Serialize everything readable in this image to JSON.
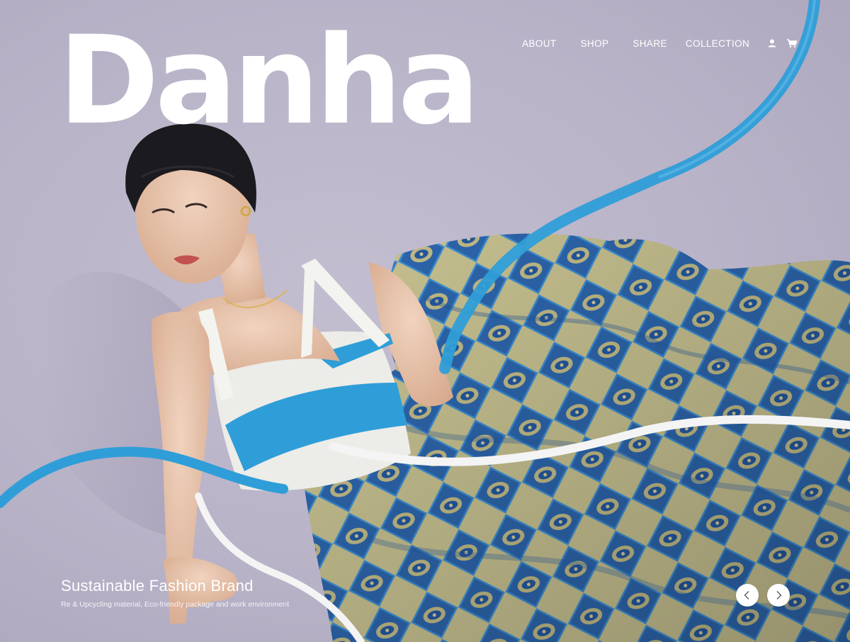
{
  "brand": {
    "logo": "Danha"
  },
  "nav": {
    "items": [
      {
        "label": "ABOUT"
      },
      {
        "label": "SHOP"
      },
      {
        "label": "SHARE"
      },
      {
        "label": "COLLECTION"
      }
    ],
    "icons": [
      "user-icon",
      "cart-icon"
    ]
  },
  "hero": {
    "title": "Sustainable Fashion Brand",
    "subtitle": "Re & Upcycling material, Eco-friendly package and work environment",
    "image": "model-in-blue-patterned-hanbok-photo"
  },
  "carousel": {
    "prev_icon": "chevron-left-icon",
    "next_icon": "chevron-right-icon"
  },
  "colors": {
    "background": "#b9b3c8",
    "ribbon_blue": "#2f9ed8",
    "fabric_blue": "#2f6db5",
    "text": "#ffffff"
  }
}
